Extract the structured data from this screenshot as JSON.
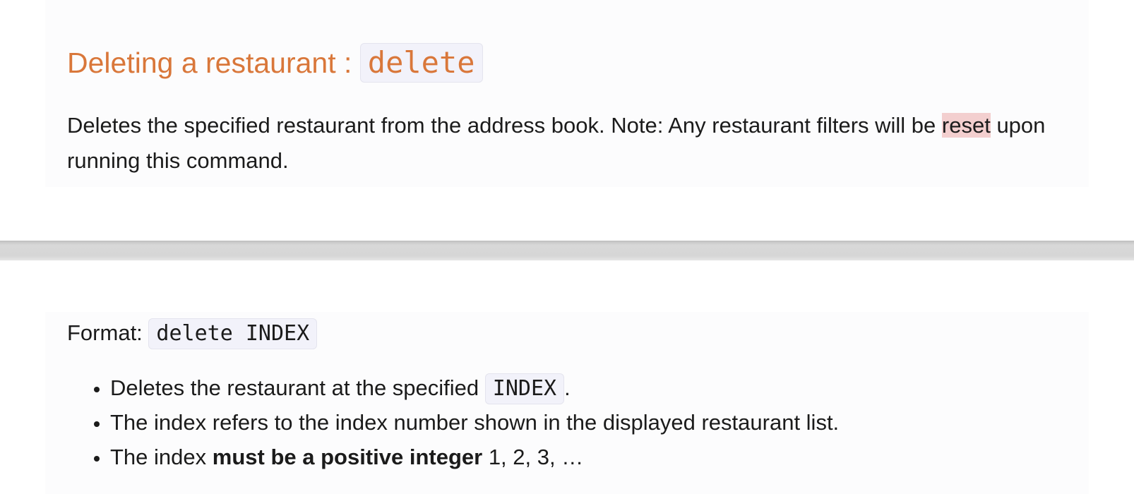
{
  "section": {
    "heading_text": "Deleting a restaurant : ",
    "heading_code": "delete",
    "description_start": "Deletes the specified restaurant from the address book. Note: Any restaurant filters will be ",
    "description_highlight": "reset",
    "description_end": " upon running this command."
  },
  "format": {
    "label": "Format: ",
    "code": "delete INDEX"
  },
  "bullets": [
    {
      "text_start": "Deletes the restaurant at the specified ",
      "code": "INDEX",
      "text_end": "."
    },
    {
      "text": "The index refers to the index number shown in the displayed restaurant list."
    },
    {
      "text_start": "The index ",
      "bold": "must be a positive integer",
      "text_end": " 1, 2, 3, …"
    }
  ],
  "colors": {
    "heading": "#d9773a",
    "highlight": "#f3cfcf",
    "code_background": "#f2f2fa"
  }
}
